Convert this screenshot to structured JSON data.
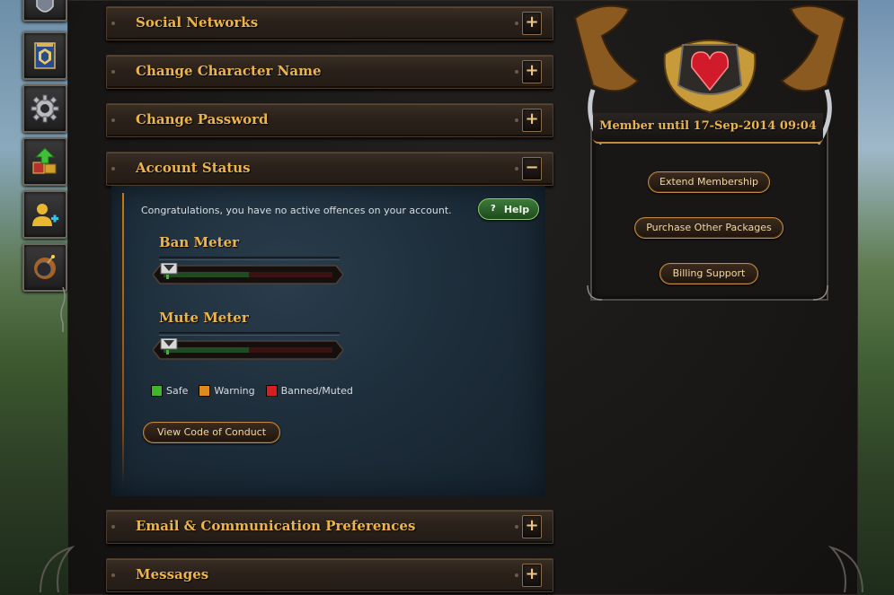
{
  "sections": {
    "social_networks": "Social Networks",
    "change_character_name": "Change Character Name",
    "change_password": "Change Password",
    "account_status": "Account Status",
    "email_preferences": "Email & Communication Preferences",
    "messages": "Messages"
  },
  "toggle": {
    "expand": "+",
    "collapse": "−"
  },
  "account_status": {
    "message": "Congratulations, you have no active offences on your account.",
    "help_label": "Help",
    "help_icon": "?",
    "ban_meter": {
      "title": "Ban Meter",
      "level": 0
    },
    "mute_meter": {
      "title": "Mute Meter",
      "level": 0
    },
    "legend": [
      {
        "label": "Safe",
        "color": "#3fb52c"
      },
      {
        "label": "Warning",
        "color": "#e08a1e"
      },
      {
        "label": "Banned/Muted",
        "color": "#d42020"
      }
    ],
    "code_of_conduct": "View Code of Conduct"
  },
  "membership": {
    "status": "Member until 17-Sep-2014 09:04",
    "extend": "Extend Membership",
    "packages": "Purchase Other Packages",
    "billing": "Billing Support"
  },
  "rail_icons": [
    "clan-banner-icon",
    "settings-gear-icon",
    "upgrade-gifts-icon",
    "add-friend-icon",
    "bomb-icon"
  ],
  "colors": {
    "accent_gold": "#ecb44a",
    "panel_blue": "#1e2e3b"
  }
}
